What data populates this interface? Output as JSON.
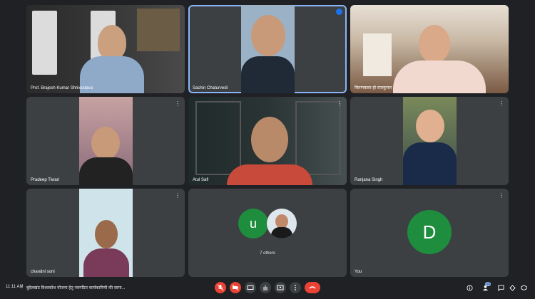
{
  "participants": [
    {
      "name": "Prof. Brajesh Kumar Shrivastava",
      "active": false
    },
    {
      "name": "Sachin Chaturvedi",
      "active": true
    },
    {
      "name": "किरणबाला हो राजकुमार",
      "active": false
    },
    {
      "name": "Pradeep Tiwari",
      "active": false
    },
    {
      "name": "Atul Safi",
      "active": false
    },
    {
      "name": "Ranjana Singh",
      "active": false
    },
    {
      "name": "chandni soni",
      "active": false
    },
    {
      "name": "7 others",
      "avatar_letter": "u",
      "avatar_color": "#1e8e3e"
    },
    {
      "name": "You",
      "avatar_letter": "D",
      "avatar_color": "#1e8e3e"
    }
  ],
  "menu_icon": "more-vert-icon",
  "bottom_bar": {
    "time": "11:11 AM",
    "separator": "|",
    "meeting_title": "बुंदेलखंड विश्वकोश योजना हेतु नवगठित कार्यकारिणी की सामा...",
    "controls": [
      {
        "name": "mic-off-icon",
        "color": "#ea4335"
      },
      {
        "name": "camera-off-icon",
        "color": "#ea4335"
      },
      {
        "name": "captions-icon",
        "color": "#3c4043"
      },
      {
        "name": "raise-hand-icon",
        "color": "#3c4043"
      },
      {
        "name": "present-icon",
        "color": "#3c4043"
      },
      {
        "name": "more-options-icon",
        "color": "#3c4043"
      },
      {
        "name": "hang-up-icon",
        "color": "#ea4335"
      }
    ],
    "right_controls": [
      {
        "name": "info-icon"
      },
      {
        "name": "people-icon",
        "badge": "12"
      },
      {
        "name": "chat-icon"
      },
      {
        "name": "activities-icon"
      },
      {
        "name": "host-controls-icon"
      }
    ]
  }
}
